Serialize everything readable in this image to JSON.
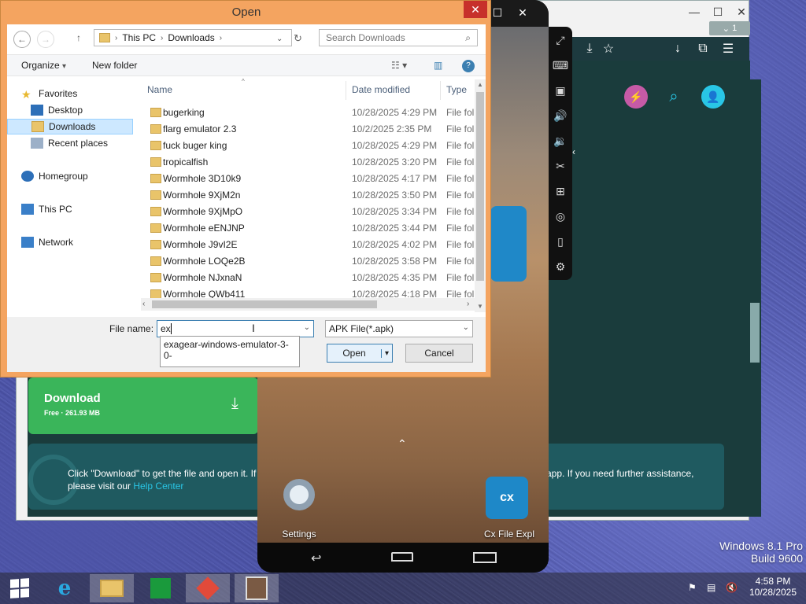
{
  "dialog": {
    "title": "Open",
    "close_label": "✕",
    "breadcrumb": [
      "This PC",
      "Downloads"
    ],
    "search_placeholder": "Search Downloads",
    "organize_label": "Organize",
    "new_folder_label": "New folder",
    "nav": {
      "favorites": "Favorites",
      "desktop": "Desktop",
      "downloads": "Downloads",
      "recent": "Recent places",
      "homegroup": "Homegroup",
      "this_pc": "This PC",
      "network": "Network"
    },
    "columns": {
      "name": "Name",
      "date": "Date modified",
      "type": "Type"
    },
    "files": [
      {
        "name": "bugerking",
        "date": "10/28/2025 4:29 PM",
        "type": "File fol"
      },
      {
        "name": "flarg emulator 2.3",
        "date": "10/2/2025 2:35 PM",
        "type": "File fol"
      },
      {
        "name": "fuck buger king",
        "date": "10/28/2025 4:29 PM",
        "type": "File fol"
      },
      {
        "name": "tropicalfish",
        "date": "10/28/2025 3:20 PM",
        "type": "File fol"
      },
      {
        "name": "Wormhole 3D10k9",
        "date": "10/28/2025 4:17 PM",
        "type": "File fol"
      },
      {
        "name": "Wormhole 9XjM2n",
        "date": "10/28/2025 3:50 PM",
        "type": "File fol"
      },
      {
        "name": "Wormhole 9XjMpO",
        "date": "10/28/2025 3:34 PM",
        "type": "File fol"
      },
      {
        "name": "Wormhole eENJNP",
        "date": "10/28/2025 3:44 PM",
        "type": "File fol"
      },
      {
        "name": "Wormhole J9vI2E",
        "date": "10/28/2025 4:02 PM",
        "type": "File fol"
      },
      {
        "name": "Wormhole LOQe2B",
        "date": "10/28/2025 3:58 PM",
        "type": "File fol"
      },
      {
        "name": "Wormhole NJxnaN",
        "date": "10/28/2025 4:35 PM",
        "type": "File fol"
      },
      {
        "name": "Wormhole QWb411",
        "date": "10/28/2025 4:18 PM",
        "type": "File fol"
      }
    ],
    "filename_label": "File name:",
    "filename_value": "ex",
    "autocomplete": "exagear-windows-emulator-3-0-",
    "filetype": "APK File(*.apk)",
    "open_label": "Open",
    "cancel_label": "Cancel"
  },
  "browser": {
    "version_badge": "1",
    "download_title": "Download",
    "download_sub": "Free · 261.93 MB",
    "info_text": "Click \"Download\" to get the file and open it. If",
    "info_text_2": "please visit our",
    "help_link": "Help Center",
    "info_text_right": "app. If you need further assistance,"
  },
  "emulator": {
    "app_settings": "Settings",
    "app_cx": "Cx File Expl"
  },
  "taskbar": {
    "time": "4:58 PM",
    "date": "10/28/2025"
  },
  "watermark": {
    "line1": "Windows 8.1 Pro",
    "line2": "Build 9600"
  },
  "colors": {
    "dialog_frame": "#f4a460",
    "download_green": "#3ab55a",
    "browser_dark": "#1a3c3c",
    "help_link": "#29c6e6"
  }
}
